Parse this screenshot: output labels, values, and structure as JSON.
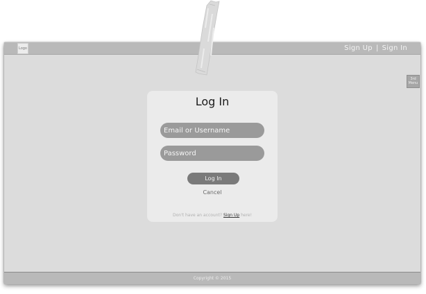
{
  "header": {
    "logo_label": "Logo",
    "signup_label": "Sign Up",
    "separator": "|",
    "signin_label": "Sign In"
  },
  "side_menu": {
    "label_line1": "3rd",
    "label_line2": "Menu"
  },
  "login_card": {
    "title": "Log In",
    "email_placeholder": "Email or Username",
    "password_placeholder": "Password",
    "login_button": "Log In",
    "cancel_label": "Cancel",
    "signup_prompt_pre": "Don't have an account? ",
    "signup_link": "Sign Up",
    "signup_prompt_post": " here!"
  },
  "footer": {
    "copyright": "Copyright © 2015"
  },
  "colors": {
    "page_background": "#dcdcdc",
    "bar_background": "#b9b9b9",
    "card_background": "#ebebeb",
    "field_background": "#9a9a9a",
    "button_background": "#7a7a7a"
  },
  "icons": {
    "decoration": "tape-strip"
  }
}
